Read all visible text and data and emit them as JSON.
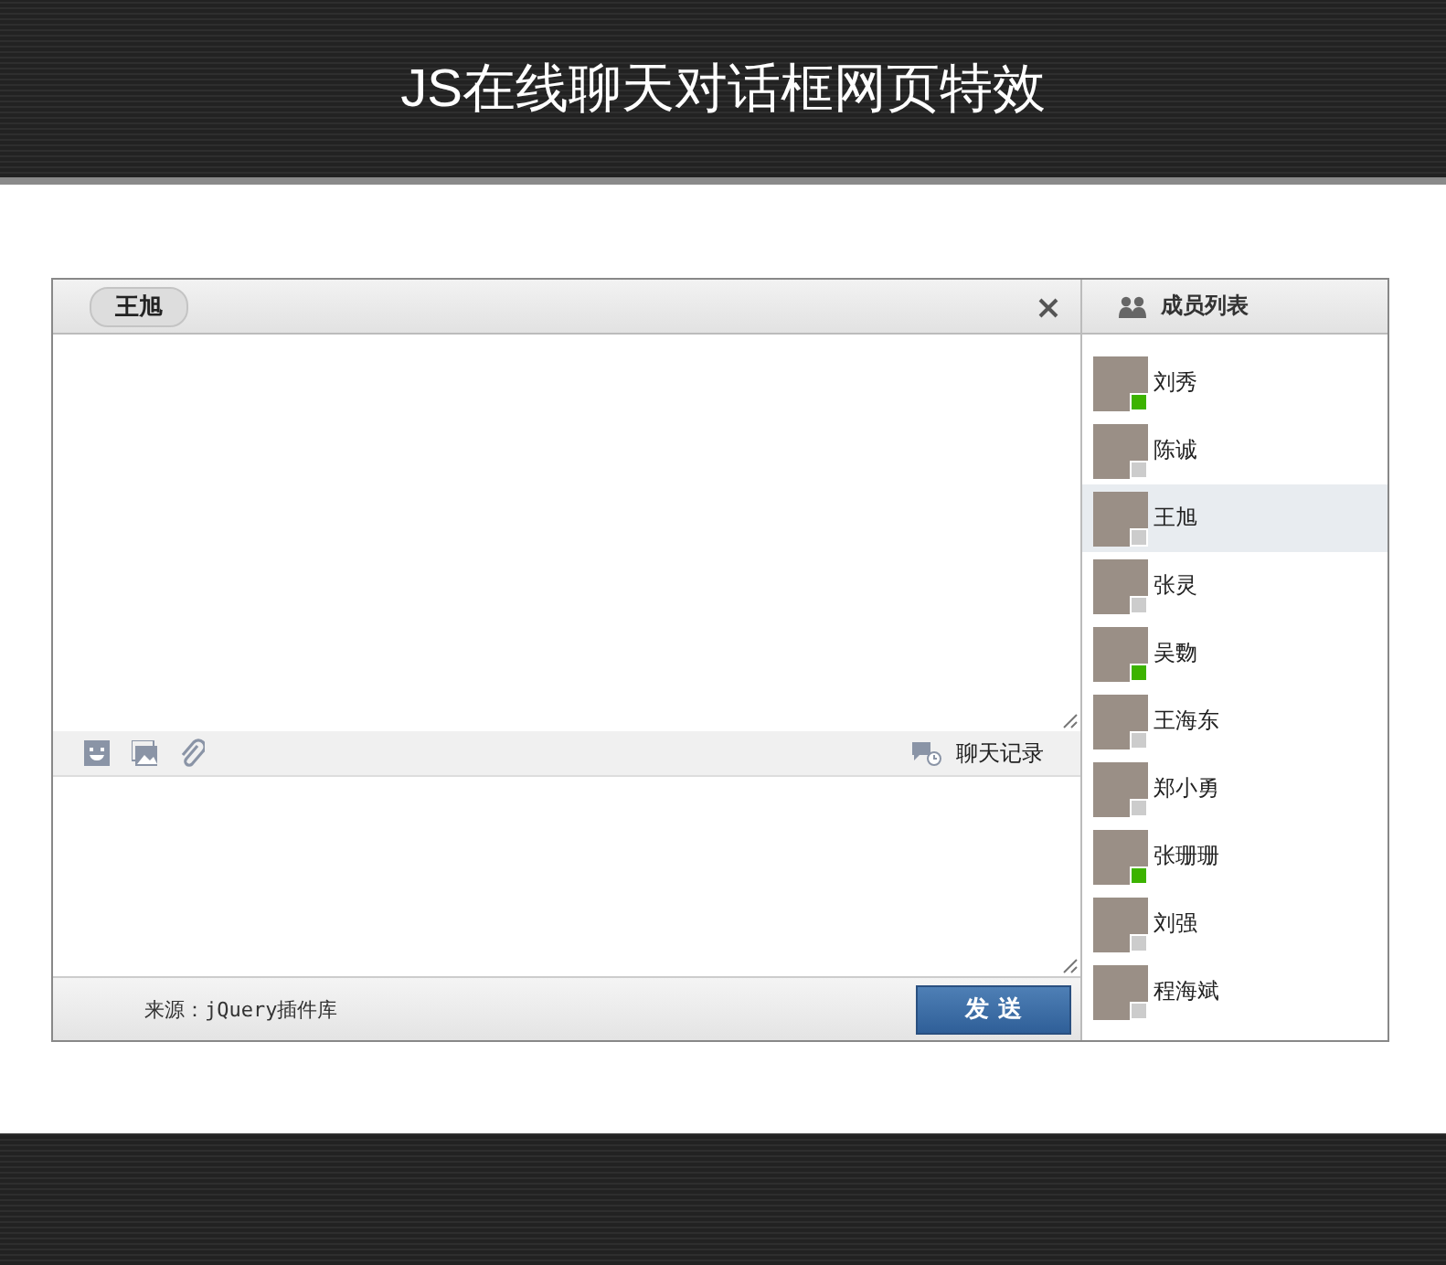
{
  "page_title": "JS在线聊天对话框网页特效",
  "chat": {
    "contact": "王旭",
    "history_label": "聊天记录",
    "source": "来源：jQuery插件库",
    "send": "发 送"
  },
  "members": {
    "title": "成员列表",
    "items": [
      {
        "name": "刘秀",
        "online": true,
        "selected": false
      },
      {
        "name": "陈诚",
        "online": false,
        "selected": false
      },
      {
        "name": "王旭",
        "online": false,
        "selected": true
      },
      {
        "name": "张灵",
        "online": false,
        "selected": false
      },
      {
        "name": "吴覅",
        "online": true,
        "selected": false
      },
      {
        "name": "王海东",
        "online": false,
        "selected": false
      },
      {
        "name": "郑小勇",
        "online": false,
        "selected": false
      },
      {
        "name": "张珊珊",
        "online": true,
        "selected": false
      },
      {
        "name": "刘强",
        "online": false,
        "selected": false
      },
      {
        "name": "程海斌",
        "online": false,
        "selected": false
      }
    ]
  }
}
